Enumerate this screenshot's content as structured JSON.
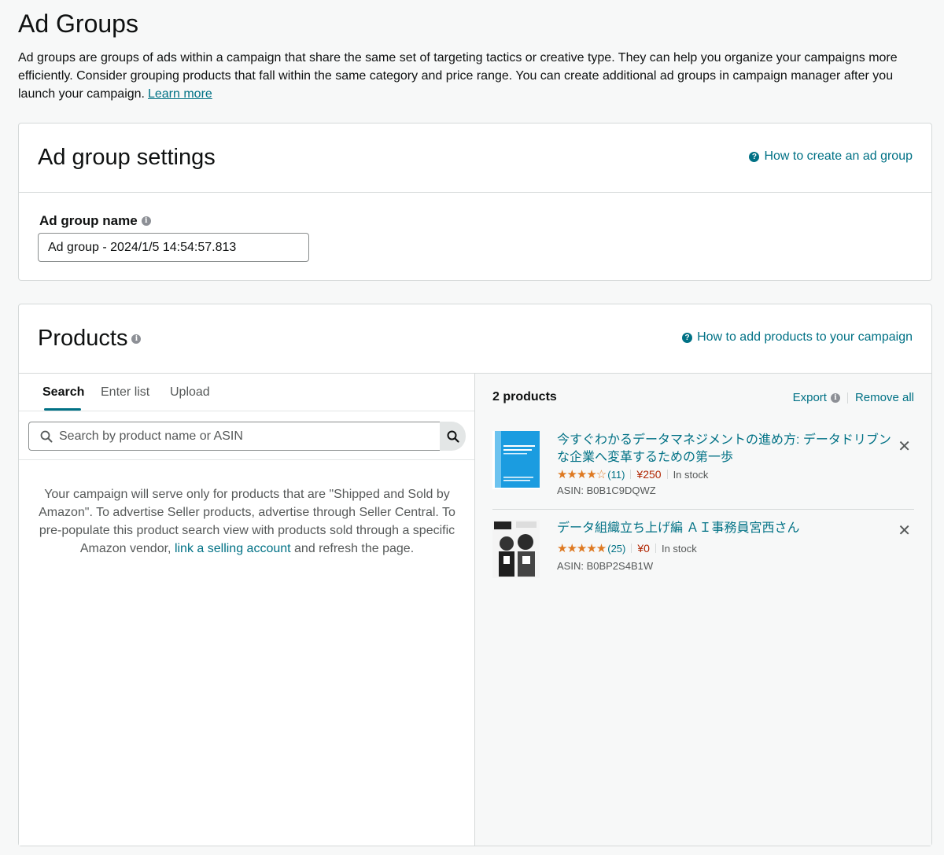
{
  "page": {
    "title": "Ad Groups",
    "intro": "Ad groups are groups of ads within a campaign that share the same set of targeting tactics or creative type. They can help you organize your campaigns more efficiently. Consider grouping products that fall within the same category and price range. You can create additional ad groups in campaign manager after you launch your campaign.",
    "learn_more": "Learn more"
  },
  "settings": {
    "title": "Ad group settings",
    "help_link": "How to create an ad group",
    "name_label": "Ad group name",
    "name_value": "Ad group - 2024/1/5 14:54:57.813"
  },
  "products": {
    "title": "Products",
    "help_link": "How to add products to your campaign",
    "tabs": [
      "Search",
      "Enter list",
      "Upload"
    ],
    "search_placeholder": "Search by product name or ASIN",
    "notice_before": "Your campaign will serve only for products that are \"Shipped and Sold by Amazon\". To advertise Seller products, advertise through Seller Central. To pre-populate this product search view with products sold through a specific Amazon vendor, ",
    "notice_link": "link a selling account",
    "notice_after": " and refresh the page.",
    "count_label": "2 products",
    "export_label": "Export",
    "remove_all_label": "Remove all",
    "items": [
      {
        "title": "今すぐわかるデータマネジメントの進め方: データドリブンな企業へ変革するための第一歩",
        "stars": "★★★★☆",
        "rating": 3.5,
        "reviews": "(11)",
        "price": "¥250",
        "stock": "In stock",
        "asin": "ASIN: B0B1C9DQWZ"
      },
      {
        "title": "データ組織立ち上げ編 ＡＩ事務員宮西さん",
        "stars": "★★★★★",
        "rating": 4.5,
        "reviews": "(25)",
        "price": "¥0",
        "stock": "In stock",
        "asin": "ASIN: B0BP2S4B1W"
      }
    ]
  },
  "colors": {
    "link": "#007185",
    "star": "#de7921",
    "price": "#b12704",
    "border": "#d5d9d9"
  }
}
